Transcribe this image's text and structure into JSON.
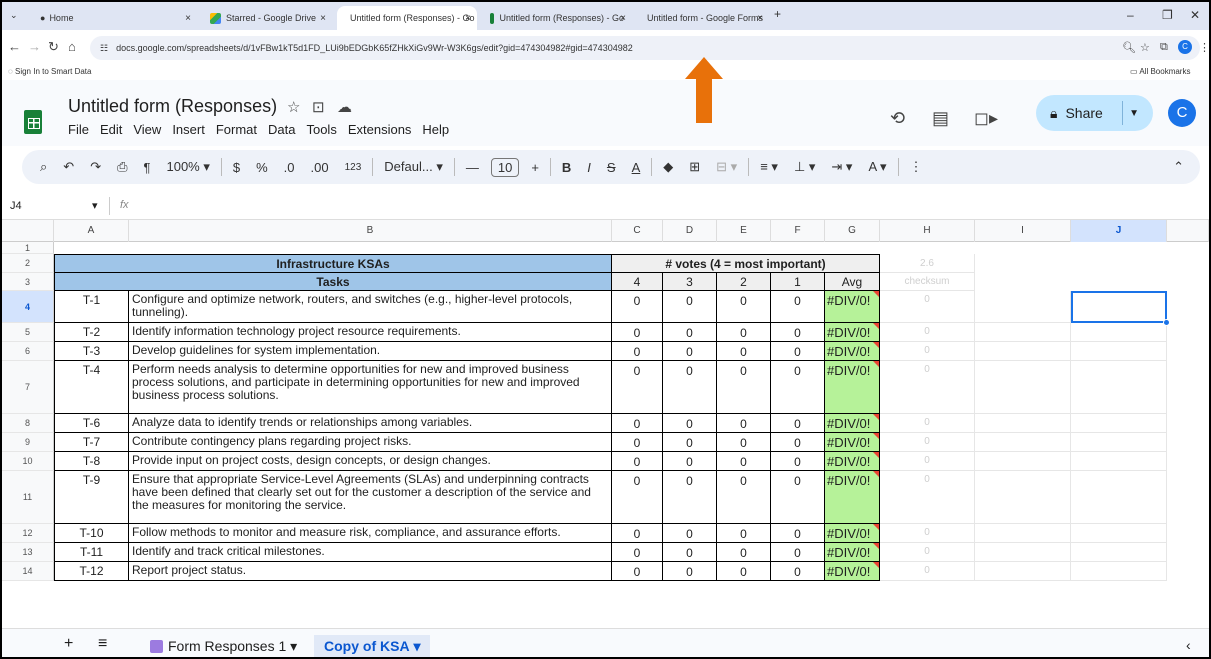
{
  "browser": {
    "tabs": [
      {
        "label": "Home"
      },
      {
        "label": "Starred - Google Drive"
      },
      {
        "label": "Untitled form (Responses) - Go"
      },
      {
        "label": "Untitled form (Responses) - Go"
      },
      {
        "label": "Untitled form - Google Forms"
      }
    ],
    "url": "docs.google.com/spreadsheets/d/1vFBw1kT5d1FD_LUi9bEDGbK65fZHkXiGv9Wr-W3K6gs/edit?gid=474304982#gid=474304982",
    "profile_initial": "C",
    "bookmark_left": "Sign In to Smart Data",
    "bookmark_right": "All Bookmarks"
  },
  "doc": {
    "title": "Untitled form (Responses)",
    "menus": [
      "File",
      "Edit",
      "View",
      "Insert",
      "Format",
      "Data",
      "Tools",
      "Extensions",
      "Help"
    ],
    "share_label": "Share",
    "avatar_initial": "C"
  },
  "toolbar": {
    "zoom": "100%",
    "currency": "$",
    "percent": "%",
    "dec_decrease": ".0",
    "dec_increase": ".00",
    "format_123": "123",
    "font": "Defaul...",
    "font_size": "10",
    "bold": "B",
    "italic": "I"
  },
  "formula_bar": {
    "cell_ref": "J4",
    "fx": "fx",
    "value": ""
  },
  "columns": [
    "A",
    "B",
    "C",
    "D",
    "E",
    "F",
    "G",
    "H",
    "I",
    "J"
  ],
  "sheet": {
    "title": "Infrastructure KSAs",
    "tasks_header": "Tasks",
    "votes_header": "# votes (4 = most important)",
    "h2_value": "2.6",
    "vote_cols": [
      "4",
      "3",
      "2",
      "1"
    ],
    "avg_header": "Avg",
    "checksum_header": "checksum",
    "rows": [
      {
        "num": "4",
        "id": "T-1",
        "task": "Configure and optimize network, routers, and switches (e.g., higher-level protocols, tunneling).",
        "v": [
          "0",
          "0",
          "0",
          "0"
        ],
        "avg": "#DIV/0!",
        "check": "0"
      },
      {
        "num": "5",
        "id": "T-2",
        "task": "Identify information technology project resource requirements.",
        "v": [
          "0",
          "0",
          "0",
          "0"
        ],
        "avg": "#DIV/0!",
        "check": "0"
      },
      {
        "num": "6",
        "id": "T-3",
        "task": "Develop guidelines for system implementation.",
        "v": [
          "0",
          "0",
          "0",
          "0"
        ],
        "avg": "#DIV/0!",
        "check": "0"
      },
      {
        "num": "7",
        "id": "T-4",
        "task": "Perform needs analysis to determine opportunities for new and improved business process solutions, and participate in determining opportunities for new and improved business process solutions.",
        "v": [
          "0",
          "0",
          "0",
          "0"
        ],
        "avg": "#DIV/0!",
        "check": "0"
      },
      {
        "num": "8",
        "id": "T-6",
        "task": "Analyze data to identify trends or relationships among variables.",
        "v": [
          "0",
          "0",
          "0",
          "0"
        ],
        "avg": "#DIV/0!",
        "check": "0"
      },
      {
        "num": "9",
        "id": "T-7",
        "task": "Contribute contingency plans regarding project risks.",
        "v": [
          "0",
          "0",
          "0",
          "0"
        ],
        "avg": "#DIV/0!",
        "check": "0"
      },
      {
        "num": "10",
        "id": "T-8",
        "task": "Provide input on project costs, design concepts, or design changes.",
        "v": [
          "0",
          "0",
          "0",
          "0"
        ],
        "avg": "#DIV/0!",
        "check": "0"
      },
      {
        "num": "11",
        "id": "T-9",
        "task": "Ensure that appropriate Service-Level Agreements (SLAs) and underpinning contracts have been defined that clearly set out for the customer a description of the service and the measures for monitoring the service.",
        "v": [
          "0",
          "0",
          "0",
          "0"
        ],
        "avg": "#DIV/0!",
        "check": "0"
      },
      {
        "num": "12",
        "id": "T-10",
        "task": "Follow methods to monitor and measure risk, compliance, and assurance efforts.",
        "v": [
          "0",
          "0",
          "0",
          "0"
        ],
        "avg": "#DIV/0!",
        "check": "0"
      },
      {
        "num": "13",
        "id": "T-11",
        "task": "Identify and track critical milestones.",
        "v": [
          "0",
          "0",
          "0",
          "0"
        ],
        "avg": "#DIV/0!",
        "check": "0"
      },
      {
        "num": "14",
        "id": "T-12",
        "task": "Report project status.",
        "v": [
          "0",
          "0",
          "0",
          "0"
        ],
        "avg": "#DIV/0!",
        "check": "0"
      }
    ]
  },
  "sheet_tabs": [
    {
      "label": "Form Responses 1"
    },
    {
      "label": "Copy of KSA"
    }
  ],
  "colors": {
    "accent": "#1a73e8",
    "header_band": "#9fc5e8",
    "avg_fill": "#b6f299",
    "arrow": "#e8710a"
  }
}
